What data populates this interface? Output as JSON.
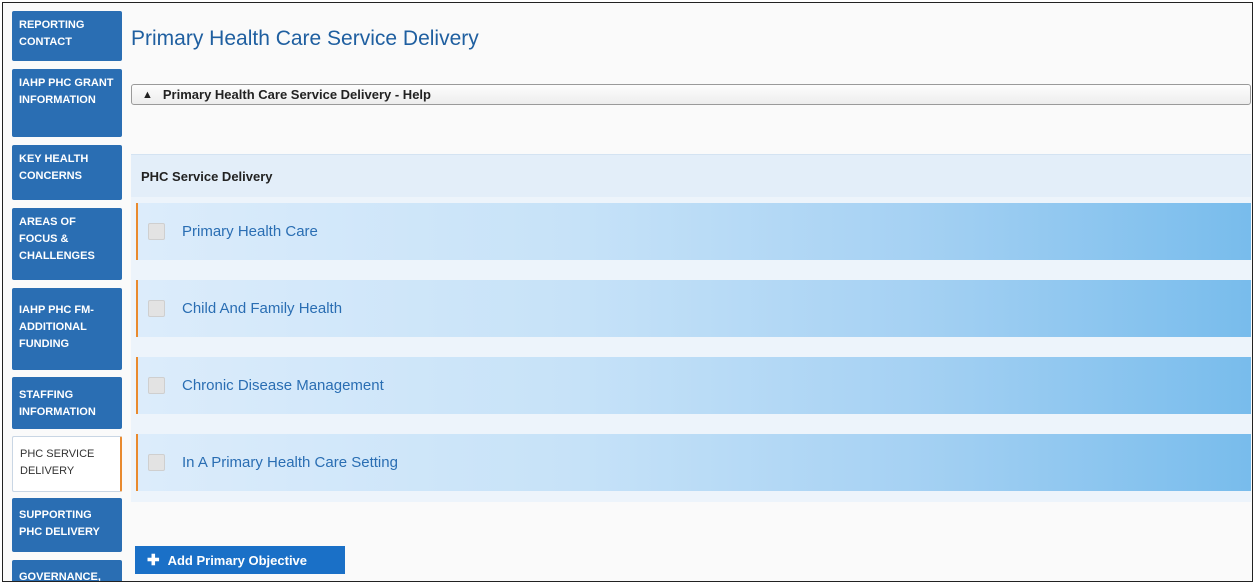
{
  "sidebar": {
    "items": [
      {
        "label": "REPORTING CONTACT"
      },
      {
        "label": "IAHP PHC GRANT INFORMATION"
      },
      {
        "label": "KEY HEALTH CONCERNS"
      },
      {
        "label": "AREAS OF FOCUS & CHALLENGES"
      },
      {
        "label": "IAHP PHC FM-ADDITIONAL FUNDING"
      },
      {
        "label": "STAFFING INFORMATION"
      },
      {
        "label": "PHC SERVICE DELIVERY"
      },
      {
        "label": "SUPPORTING PHC DELIVERY"
      },
      {
        "label": "GOVERNANCE, LEADERSHIP &"
      }
    ]
  },
  "main": {
    "title": "Primary Health Care Service Delivery",
    "help_label": "Primary Health Care Service Delivery - Help",
    "section_title": "PHC Service Delivery",
    "rows": [
      {
        "label": "Primary Health Care"
      },
      {
        "label": "Child And Family Health"
      },
      {
        "label": "Chronic Disease Management"
      },
      {
        "label": "In A Primary Health Care Setting"
      }
    ],
    "add_button_label": "Add Primary Objective"
  }
}
